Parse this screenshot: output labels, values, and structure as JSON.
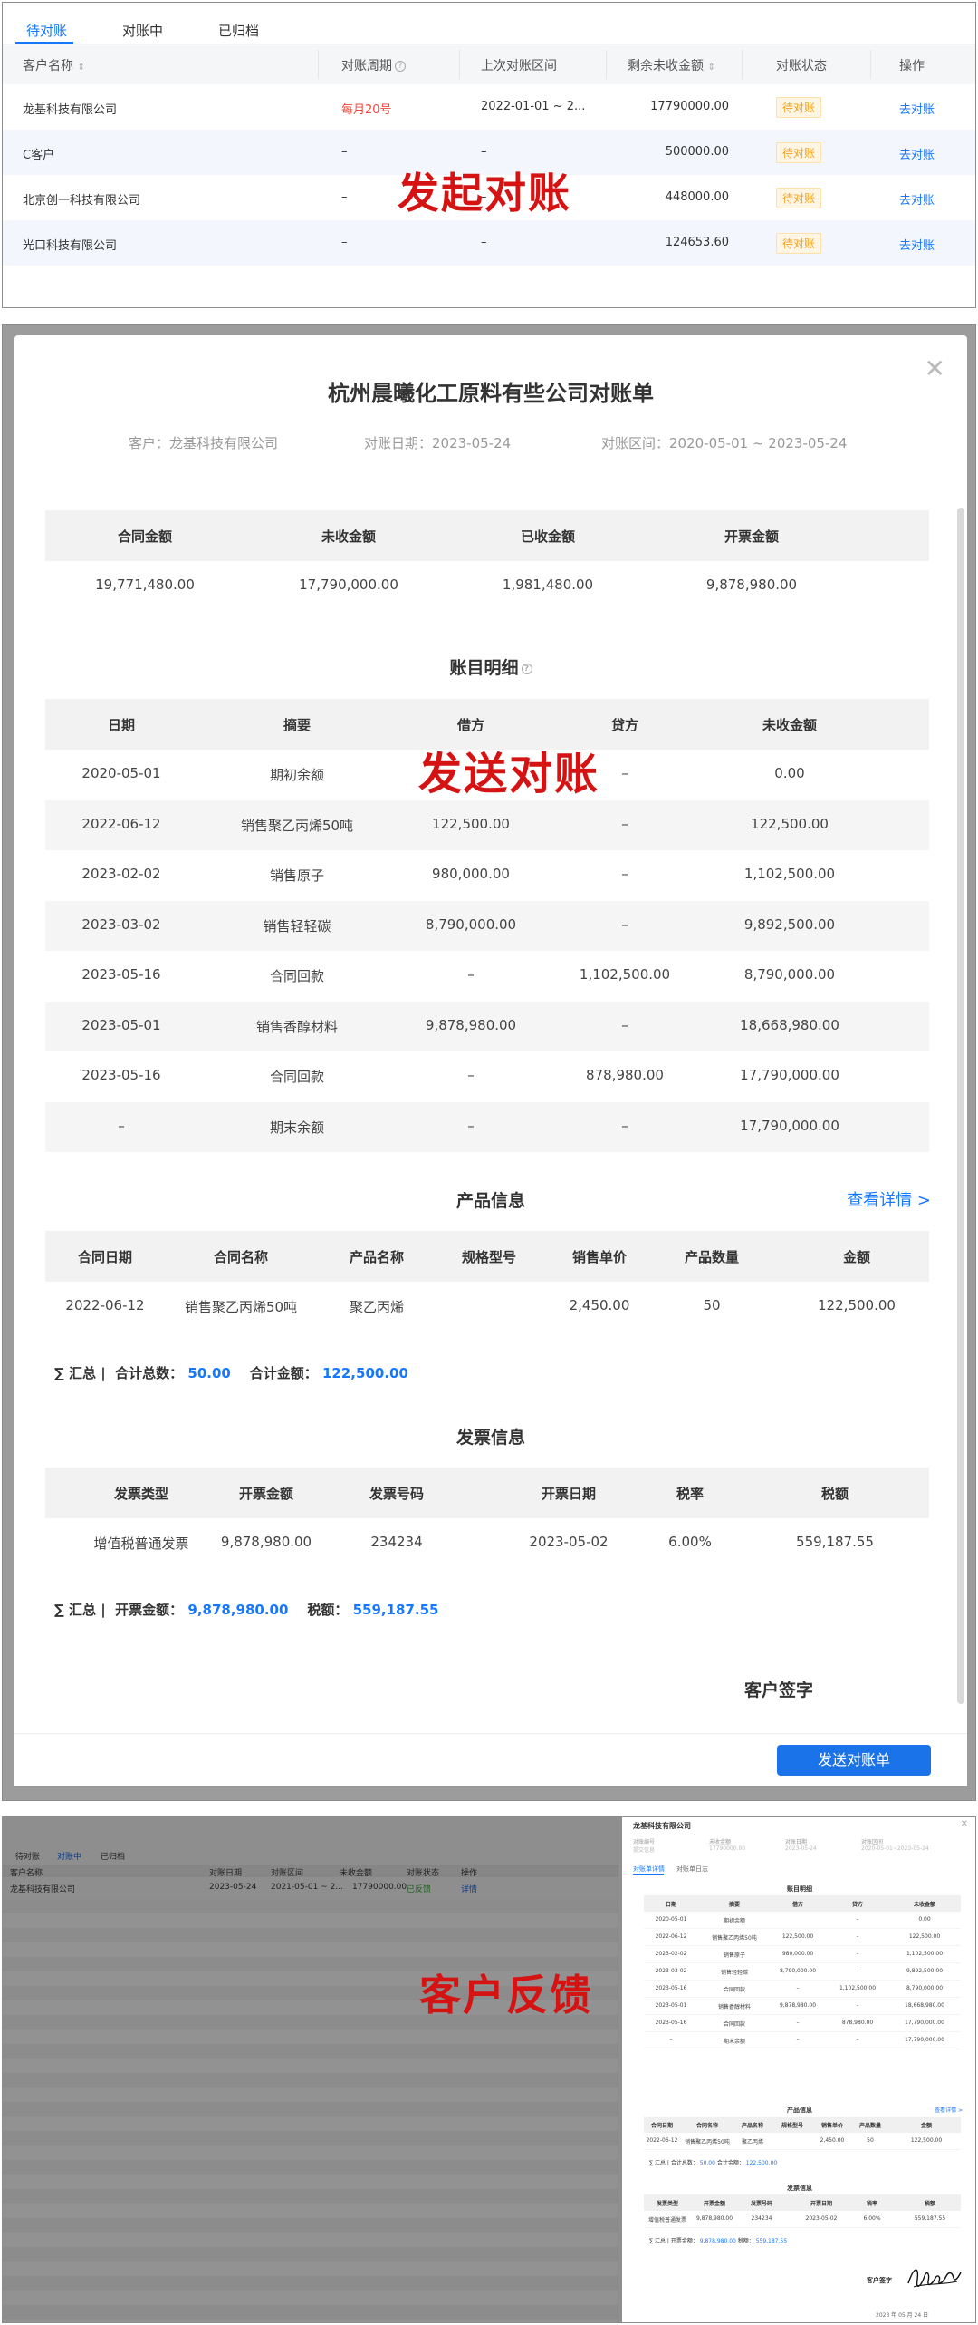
{
  "labels": {
    "p1": "发起对账",
    "p2": "发送对账",
    "p3": "客户反馈"
  },
  "list": {
    "tabs": [
      "待对账",
      "对账中",
      "已归档"
    ],
    "columns": [
      "客户名称",
      "对账周期",
      "上次对账区间",
      "剩余未收金额",
      "对账状态",
      "操作"
    ],
    "rows": [
      {
        "name": "龙基科技有限公司",
        "cycle": "每月20号",
        "last": "2022-01-01 ~ 2...",
        "amount": "17790000.00",
        "status": "待对账",
        "action": "去对账"
      },
      {
        "name": "C客户",
        "cycle": "–",
        "last": "–",
        "amount": "500000.00",
        "status": "待对账",
        "action": "去对账"
      },
      {
        "name": "北京创一科技有限公司",
        "cycle": "–",
        "last": "–",
        "amount": "448000.00",
        "status": "待对账",
        "action": "去对账"
      },
      {
        "name": "光口科技有限公司",
        "cycle": "–",
        "last": "–",
        "amount": "124653.60",
        "status": "待对账",
        "action": "去对账"
      }
    ]
  },
  "statement": {
    "title": "杭州晨曦化工原料有些公司对账单",
    "customer": "客户：龙基科技有限公司",
    "date": "对账日期：2023-05-24",
    "range": "对账区间：2020-05-01 ~ 2023-05-24",
    "summary_head": [
      "合同金额",
      "未收金额",
      "已收金额",
      "开票金额"
    ],
    "summary_vals": [
      "19,771,480.00",
      "17,790,000.00",
      "1,981,480.00",
      "9,878,980.00"
    ],
    "ledger_title": "账目明细",
    "ledger_head": [
      "日期",
      "摘要",
      "借方",
      "贷方",
      "未收金额"
    ],
    "ledger_rows": [
      [
        "2020-05-01",
        "期初余额",
        "",
        "–",
        "0.00"
      ],
      [
        "2022-06-12",
        "销售聚乙丙烯50吨",
        "122,500.00",
        "–",
        "122,500.00"
      ],
      [
        "2023-02-02",
        "销售原子",
        "980,000.00",
        "–",
        "1,102,500.00"
      ],
      [
        "2023-03-02",
        "销售轻轻碳",
        "8,790,000.00",
        "–",
        "9,892,500.00"
      ],
      [
        "2023-05-16",
        "合同回款",
        "–",
        "1,102,500.00",
        "8,790,000.00"
      ],
      [
        "2023-05-01",
        "销售香醇材料",
        "9,878,980.00",
        "–",
        "18,668,980.00"
      ],
      [
        "2023-05-16",
        "合同回款",
        "–",
        "878,980.00",
        "17,790,000.00"
      ],
      [
        "–",
        "期末余额",
        "–",
        "–",
        "17,790,000.00"
      ]
    ],
    "product_title": "产品信息",
    "product_link": "查看详情 >",
    "product_head": [
      "合同日期",
      "合同名称",
      "产品名称",
      "规格型号",
      "销售单价",
      "产品数量",
      "金额"
    ],
    "product_rows": [
      [
        "2022-06-12",
        "销售聚乙丙烯50吨",
        "聚乙丙烯",
        "",
        "2,450.00",
        "50",
        "122,500.00"
      ]
    ],
    "product_sum_prefix": "∑ 汇总 |",
    "product_sum_qty_label": "合计总数：",
    "product_sum_qty": "50.00",
    "product_sum_amt_label": "合计金额：",
    "product_sum_amt": "122,500.00",
    "invoice_title": "发票信息",
    "invoice_head": [
      "发票类型",
      "开票金额",
      "发票号码",
      "开票日期",
      "税率",
      "税额"
    ],
    "invoice_rows": [
      [
        "增值税普通发票",
        "9,878,980.00",
        "234234",
        "2023-05-02",
        "6.00%",
        "559,187.55"
      ]
    ],
    "invoice_sum_prefix": "∑ 汇总 |",
    "invoice_sum_amt_label": "开票金额：",
    "invoice_sum_amt": "9,878,980.00",
    "invoice_sum_tax_label": "税额：",
    "invoice_sum_tax": "559,187.55",
    "sign_label": "客户签字",
    "send_button": "发送对账单"
  },
  "feedback": {
    "bg_tabs": [
      "待对账",
      "对账中",
      "已归档"
    ],
    "bg_columns": [
      "客户名称",
      "对账日期",
      "对账区间",
      "未收金额",
      "对账状态",
      "操作"
    ],
    "bg_row": [
      "龙基科技有限公司",
      "2023-05-24",
      "2021-05-01 ~ 2...",
      "17790000.00",
      "已反馈",
      "详情"
    ],
    "drawer_title": "龙基科技有限公司",
    "drawer_meta_labels": [
      "对账编号",
      "未收金额",
      "对账日期",
      "对账区间"
    ],
    "drawer_meta_vals": [
      "提交信息",
      "17790000.00",
      "2023-05-24",
      "2020-05-01~2023-05-24"
    ],
    "drawer_tabs": [
      "对账单详情",
      "对账单日志"
    ],
    "ledger_title": "账目明细",
    "product_title": "产品信息",
    "product_link": "查看详情 >",
    "invoice_title": "发票信息",
    "sign_label": "客户签字",
    "sign_date": "2023 年    05 月    24 日"
  }
}
